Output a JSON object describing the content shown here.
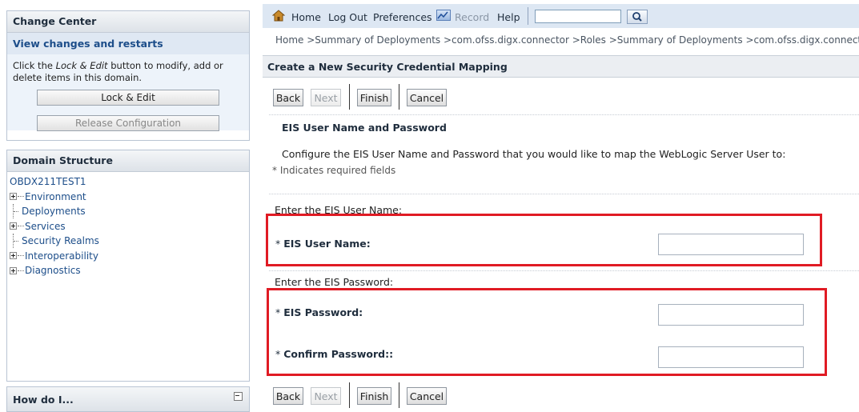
{
  "change_center": {
    "title": "Change Center",
    "subtitle": "View changes and restarts",
    "desc_before": "Click the ",
    "desc_em": "Lock & Edit",
    "desc_after": " button to modify, add or delete items in this domain.",
    "lock_edit_label": "Lock & Edit",
    "release_label": "Release Configuration"
  },
  "domain_structure": {
    "title": "Domain Structure",
    "root": "OBDX211TEST1",
    "items": [
      {
        "label": "Environment",
        "expandable": true
      },
      {
        "label": "Deployments",
        "expandable": false
      },
      {
        "label": "Services",
        "expandable": true
      },
      {
        "label": "Security Realms",
        "expandable": false
      },
      {
        "label": "Interoperability",
        "expandable": true
      },
      {
        "label": "Diagnostics",
        "expandable": true
      }
    ]
  },
  "how_do_i": {
    "title": "How do I..."
  },
  "topbar": {
    "home": "Home",
    "logout": "Log Out",
    "preferences": "Preferences",
    "record": "Record",
    "help": "Help",
    "search_value": ""
  },
  "breadcrumb": "Home >Summary of Deployments >com.ofss.digx.connector >Roles >Summary of Deployments >com.ofss.digx.connector >Roles",
  "page": {
    "title": "Create a New Security Credential Mapping",
    "buttons": {
      "back": "Back",
      "next": "Next",
      "finish": "Finish",
      "cancel": "Cancel"
    },
    "section_title": "EIS User Name and Password",
    "description": "Configure the EIS User Name and Password that you would like to map the WebLogic Server User to:",
    "required_note": "* Indicates required fields",
    "user_group_label": "Enter the EIS User Name:",
    "user_name_label": "EIS User Name:",
    "password_group_label": "Enter the EIS Password:",
    "password_label": "EIS Password:",
    "confirm_label": "Confirm Password::",
    "star": "* ",
    "user_name_value": "",
    "password_value": "",
    "confirm_value": ""
  },
  "colors": {
    "highlight": "#e01b24",
    "link": "#1d4e8a",
    "topbar_bg": "#dde7f3"
  }
}
